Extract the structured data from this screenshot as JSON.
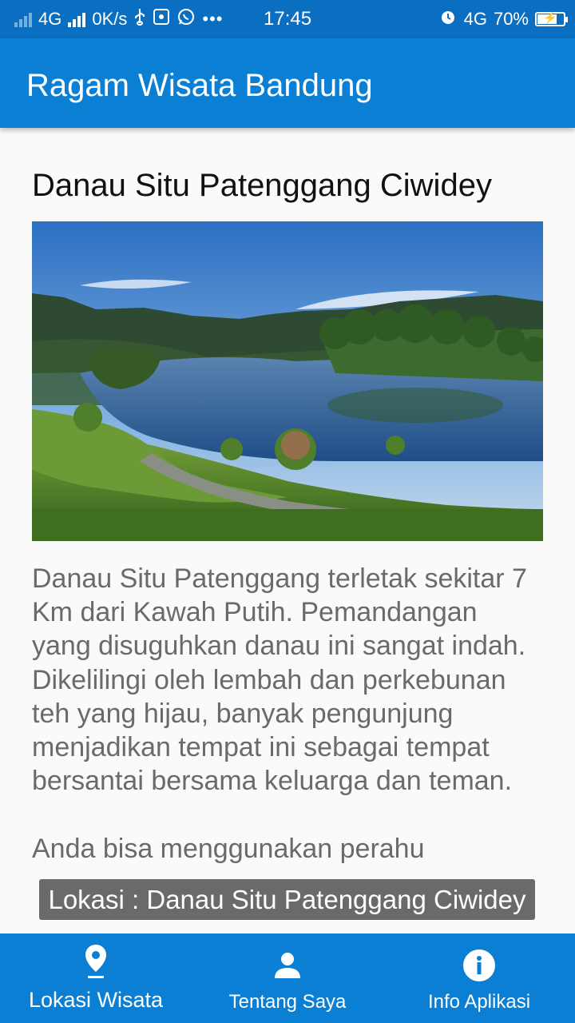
{
  "status_bar": {
    "network_left": "4G",
    "speed": "0K/s",
    "time": "17:45",
    "network_right": "4G",
    "battery": "70%",
    "battery_level": 0.7,
    "icons": [
      "signal-icon",
      "usb-icon",
      "whatsapp-icon",
      "more-icon",
      "alarm-icon",
      "battery-icon"
    ]
  },
  "app_bar": {
    "title": "Ragam Wisata Bandung"
  },
  "content": {
    "title": "Danau Situ Patenggang Ciwidey",
    "description": "Danau Situ Patenggang terletak sekitar 7 Km dari Kawah Putih. Pemandangan yang disuguhkan danau ini sangat indah. Dikelilingi oleh lembah dan perkebunan teh yang hijau, banyak pengunjung menjadikan tempat ini sebagai tempat bersantai bersama keluarga dan teman.",
    "description_more": "Anda bisa menggunakan perahu"
  },
  "toast": {
    "text": "Lokasi : Danau Situ Patenggang Ciwidey"
  },
  "bottom_nav": {
    "items": [
      {
        "label": "Lokasi Wisata",
        "icon": "location-pin-icon",
        "active": true
      },
      {
        "label": "Tentang Saya",
        "icon": "person-icon",
        "active": false
      },
      {
        "label": "Info Aplikasi",
        "icon": "info-icon",
        "active": false
      }
    ]
  },
  "colors": {
    "primary": "#0a7fd3",
    "status_bar": "#0a6fc1",
    "text_secondary": "#6a6a6a"
  }
}
